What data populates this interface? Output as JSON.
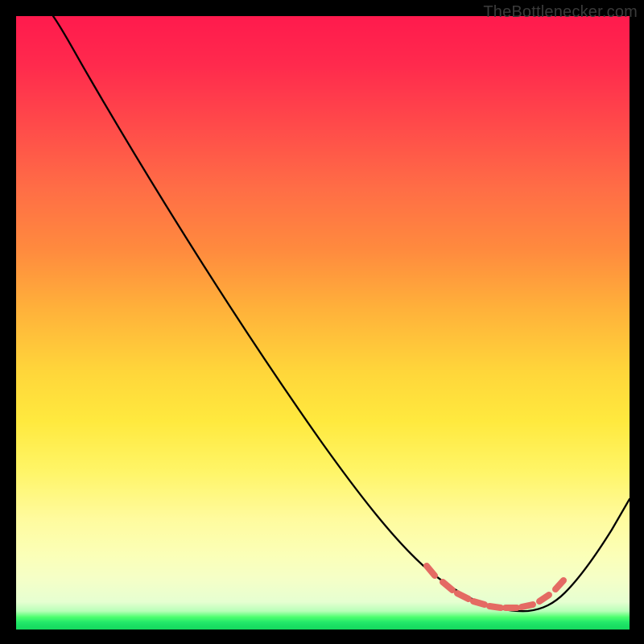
{
  "watermark": {
    "text": "TheBottlenecker.com"
  },
  "chart_data": {
    "type": "line",
    "title": "",
    "xlabel": "",
    "ylabel": "",
    "xlim": [
      0,
      100
    ],
    "ylim": [
      0,
      100
    ],
    "series": [
      {
        "name": "bottleneck-curve",
        "x": [
          6,
          10,
          16,
          24,
          32,
          40,
          48,
          56,
          62,
          66,
          69,
          72,
          75,
          78,
          81,
          83,
          85,
          88,
          92,
          96,
          100
        ],
        "y": [
          100,
          96,
          88,
          77,
          66,
          55,
          44,
          33,
          25,
          19,
          14,
          10,
          7,
          5,
          4,
          3.5,
          3.3,
          4.5,
          9,
          16,
          24
        ]
      }
    ],
    "markers": {
      "name": "optimum-band",
      "color": "#e46a63",
      "points": [
        {
          "x": 69,
          "y": 12
        },
        {
          "x": 71,
          "y": 9
        },
        {
          "x": 73,
          "y": 7
        },
        {
          "x": 75,
          "y": 5.5
        },
        {
          "x": 77,
          "y": 4.8
        },
        {
          "x": 79,
          "y": 4.2
        },
        {
          "x": 81,
          "y": 4.0
        },
        {
          "x": 83,
          "y": 4.1
        },
        {
          "x": 85,
          "y": 5.0
        },
        {
          "x": 87,
          "y": 7.0
        }
      ]
    },
    "gradient_stops": [
      {
        "pos": 0.0,
        "color": "#ff1a4d"
      },
      {
        "pos": 0.5,
        "color": "#ffd63a"
      },
      {
        "pos": 0.9,
        "color": "#f4ffc8"
      },
      {
        "pos": 0.98,
        "color": "#24e86a"
      },
      {
        "pos": 1.0,
        "color": "#17d95f"
      }
    ]
  }
}
